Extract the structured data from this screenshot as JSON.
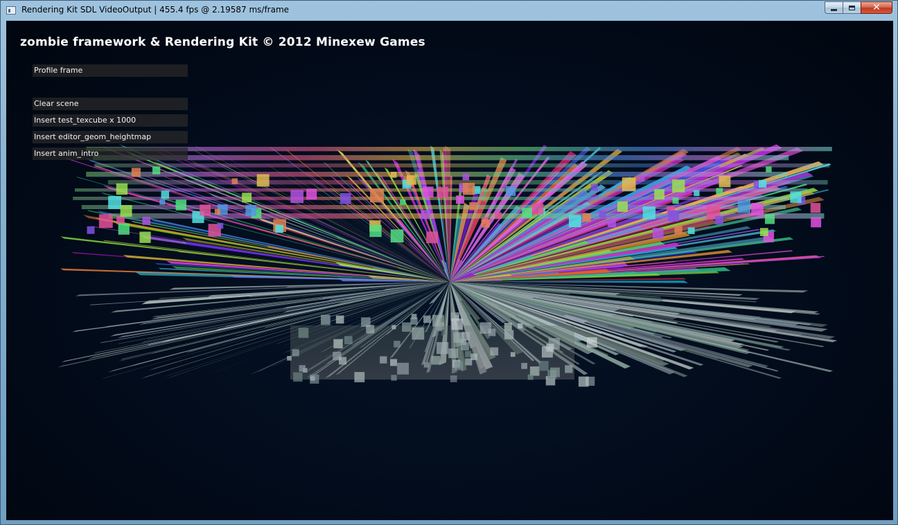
{
  "window": {
    "title": "Rendering Kit SDL VideoOutput | 455.4 fps @ 2.19587 ms/frame",
    "app_icon": "window-app-icon",
    "minimize_icon": "minimize-icon",
    "maximize_icon": "maximize-icon",
    "close_label": "✕"
  },
  "viewport": {
    "banner": "zombie framework & Rendering Kit © 2012 Minexew Games",
    "menu": [
      {
        "label": "Profile frame"
      },
      {
        "label": "Clear scene"
      },
      {
        "label": "Insert test_texcube x 1000"
      },
      {
        "label": "Insert editor_geom_heightmap"
      },
      {
        "label": "Insert anim_intro"
      }
    ]
  },
  "colors": {
    "background": "#020b1a",
    "button_bg": "#282828",
    "text": "#ffffff"
  }
}
